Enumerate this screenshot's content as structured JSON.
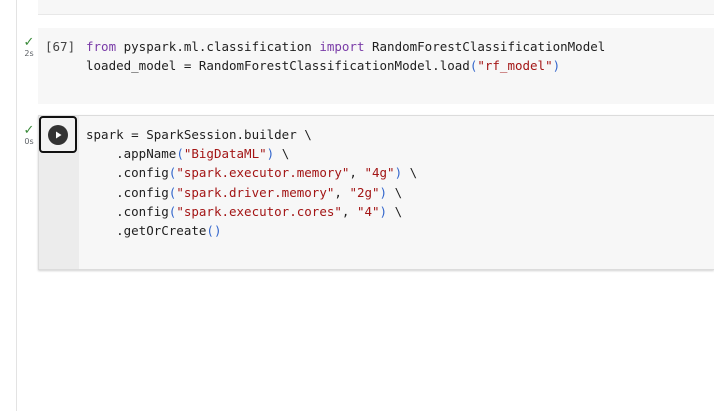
{
  "cells": [
    {
      "exec_label": "[67]",
      "status_icon": "check-icon",
      "status_mark": "✓",
      "time": "2s",
      "lines": [
        [
          {
            "t": "from",
            "c": "kw"
          },
          {
            "t": " pyspark.ml.classification "
          },
          {
            "t": "import",
            "c": "kw"
          },
          {
            "t": " RandomForestClassificationModel"
          }
        ],
        [
          {
            "t": "loaded_model = RandomForestClassificationModel.load"
          },
          {
            "t": "(",
            "c": "paren"
          },
          {
            "t": "\"rf_model\"",
            "c": "str"
          },
          {
            "t": ")",
            "c": "paren"
          }
        ]
      ]
    },
    {
      "exec_label": "",
      "status_icon": "check-icon",
      "status_mark": "✓",
      "time": "0s",
      "run_icon": "play-icon",
      "lines": [
        [
          {
            "t": "spark = SparkSession.builder \\"
          }
        ],
        [
          {
            "t": "    .appName"
          },
          {
            "t": "(",
            "c": "paren"
          },
          {
            "t": "\"BigDataML\"",
            "c": "str"
          },
          {
            "t": ")",
            "c": "paren"
          },
          {
            "t": " \\"
          }
        ],
        [
          {
            "t": "    .config"
          },
          {
            "t": "(",
            "c": "paren"
          },
          {
            "t": "\"spark.executor.memory\"",
            "c": "str"
          },
          {
            "t": ", "
          },
          {
            "t": "\"4g\"",
            "c": "str"
          },
          {
            "t": ")",
            "c": "paren"
          },
          {
            "t": " \\"
          }
        ],
        [
          {
            "t": "    .config"
          },
          {
            "t": "(",
            "c": "paren"
          },
          {
            "t": "\"spark.driver.memory\"",
            "c": "str"
          },
          {
            "t": ", "
          },
          {
            "t": "\"2g\"",
            "c": "str"
          },
          {
            "t": ")",
            "c": "paren"
          },
          {
            "t": " \\"
          }
        ],
        [
          {
            "t": "    .config"
          },
          {
            "t": "(",
            "c": "paren"
          },
          {
            "t": "\"spark.executor.cores\"",
            "c": "str"
          },
          {
            "t": ", "
          },
          {
            "t": "\"4\"",
            "c": "str"
          },
          {
            "t": ")",
            "c": "paren"
          },
          {
            "t": " \\"
          }
        ],
        [
          {
            "t": "    .getOrCreate"
          },
          {
            "t": "()",
            "c": "paren"
          }
        ]
      ]
    }
  ]
}
